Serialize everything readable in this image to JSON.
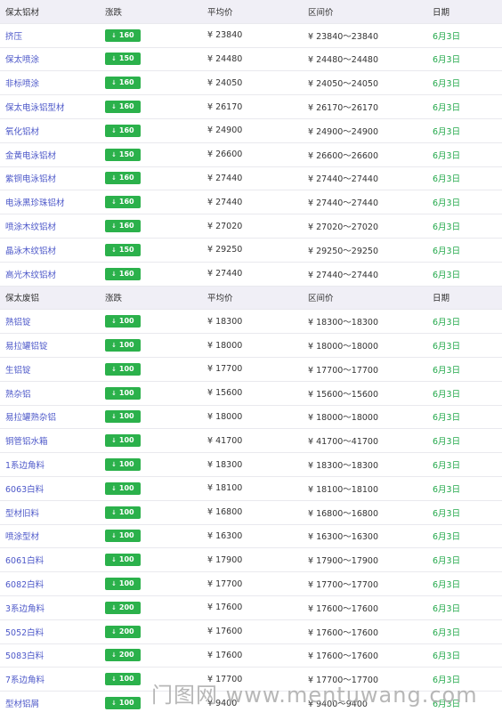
{
  "sections": [
    {
      "header": {
        "name": "保太铝材",
        "change": "涨跌",
        "avg": "平均价",
        "range": "区间价",
        "date": "日期"
      },
      "rows": [
        {
          "name": "挤压",
          "change": "160",
          "avg": "¥ 23840",
          "range": "¥ 23840～23840",
          "date": "6月3日"
        },
        {
          "name": "保太喷涂",
          "change": "150",
          "avg": "¥ 24480",
          "range": "¥ 24480～24480",
          "date": "6月3日"
        },
        {
          "name": "非标喷涂",
          "change": "160",
          "avg": "¥ 24050",
          "range": "¥ 24050～24050",
          "date": "6月3日"
        },
        {
          "name": "保太电泳铝型材",
          "change": "160",
          "avg": "¥ 26170",
          "range": "¥ 26170～26170",
          "date": "6月3日"
        },
        {
          "name": "氧化铝材",
          "change": "160",
          "avg": "¥ 24900",
          "range": "¥ 24900～24900",
          "date": "6月3日"
        },
        {
          "name": "金黄电泳铝材",
          "change": "150",
          "avg": "¥ 26600",
          "range": "¥ 26600～26600",
          "date": "6月3日"
        },
        {
          "name": "紫铜电泳铝材",
          "change": "160",
          "avg": "¥ 27440",
          "range": "¥ 27440～27440",
          "date": "6月3日"
        },
        {
          "name": "电泳黑珍珠铝材",
          "change": "160",
          "avg": "¥ 27440",
          "range": "¥ 27440～27440",
          "date": "6月3日"
        },
        {
          "name": "喷涂木纹铝材",
          "change": "160",
          "avg": "¥ 27020",
          "range": "¥ 27020～27020",
          "date": "6月3日"
        },
        {
          "name": "晶泳木纹铝材",
          "change": "150",
          "avg": "¥ 29250",
          "range": "¥ 29250～29250",
          "date": "6月3日"
        },
        {
          "name": "高光木纹铝材",
          "change": "160",
          "avg": "¥ 27440",
          "range": "¥ 27440～27440",
          "date": "6月3日"
        }
      ]
    },
    {
      "header": {
        "name": "保太废铝",
        "change": "涨跌",
        "avg": "平均价",
        "range": "区间价",
        "date": "日期"
      },
      "rows": [
        {
          "name": "熟铝锭",
          "change": "100",
          "avg": "¥ 18300",
          "range": "¥ 18300～18300",
          "date": "6月3日"
        },
        {
          "name": "易拉罐铝锭",
          "change": "100",
          "avg": "¥ 18000",
          "range": "¥ 18000～18000",
          "date": "6月3日"
        },
        {
          "name": "生铝锭",
          "change": "100",
          "avg": "¥ 17700",
          "range": "¥ 17700～17700",
          "date": "6月3日"
        },
        {
          "name": "熟杂铝",
          "change": "100",
          "avg": "¥ 15600",
          "range": "¥ 15600～15600",
          "date": "6月3日"
        },
        {
          "name": "易拉罐熟杂铝",
          "change": "100",
          "avg": "¥ 18000",
          "range": "¥ 18000～18000",
          "date": "6月3日"
        },
        {
          "name": "铜管铝水箱",
          "change": "100",
          "avg": "¥ 41700",
          "range": "¥ 41700～41700",
          "date": "6月3日"
        },
        {
          "name": "1系边角料",
          "change": "100",
          "avg": "¥ 18300",
          "range": "¥ 18300～18300",
          "date": "6月3日"
        },
        {
          "name": "6063白料",
          "change": "100",
          "avg": "¥ 18100",
          "range": "¥ 18100～18100",
          "date": "6月3日"
        },
        {
          "name": "型材旧料",
          "change": "100",
          "avg": "¥ 16800",
          "range": "¥ 16800～16800",
          "date": "6月3日"
        },
        {
          "name": "喷涂型材",
          "change": "100",
          "avg": "¥ 16300",
          "range": "¥ 16300～16300",
          "date": "6月3日"
        },
        {
          "name": "6061白料",
          "change": "100",
          "avg": "¥ 17900",
          "range": "¥ 17900～17900",
          "date": "6月3日"
        },
        {
          "name": "6082白料",
          "change": "100",
          "avg": "¥ 17700",
          "range": "¥ 17700～17700",
          "date": "6月3日"
        },
        {
          "name": "3系边角料",
          "change": "200",
          "avg": "¥ 17600",
          "range": "¥ 17600～17600",
          "date": "6月3日"
        },
        {
          "name": "5052白料",
          "change": "200",
          "avg": "¥ 17600",
          "range": "¥ 17600～17600",
          "date": "6月3日"
        },
        {
          "name": "5083白料",
          "change": "200",
          "avg": "¥ 17600",
          "range": "¥ 17600～17600",
          "date": "6月3日"
        },
        {
          "name": "7系边角料",
          "change": "100",
          "avg": "¥ 17700",
          "range": "¥ 17700～17700",
          "date": "6月3日"
        },
        {
          "name": "型材铝屑",
          "change": "100",
          "avg": "¥ 9400",
          "range": "¥ 9400～9400",
          "date": "6月3日"
        }
      ]
    }
  ],
  "badge": {
    "arrow": "↓",
    "color": "#2bb14b"
  },
  "watermark": {
    "text": "门图网 www.mentuwang.com"
  }
}
